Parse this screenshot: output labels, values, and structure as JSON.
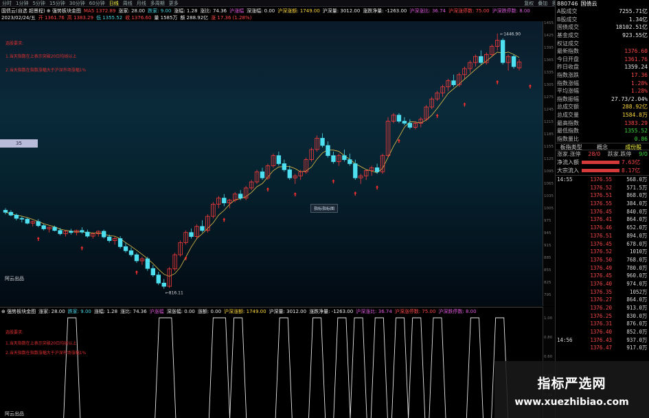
{
  "toolbar": {
    "left": [
      "分时",
      "1分钟",
      "5分钟",
      "15分钟",
      "30分钟",
      "60分钟",
      "日线",
      "周线",
      "月线",
      "多周期",
      "更多"
    ],
    "active_index": 6,
    "right": [
      "复权",
      "叠加",
      "多股",
      "统计",
      "画线",
      "F10",
      "标记",
      "+自选",
      "返回"
    ]
  },
  "infoline": [
    {
      "t": "国债云(自选 超景程) ⊕ 强势板块金图",
      "c": "white"
    },
    {
      "t": "MA5 1372.89",
      "c": "red"
    },
    {
      "t": "涨家: 28.00",
      "c": "white"
    },
    {
      "t": "跌家: 9.00",
      "c": "cyan"
    },
    {
      "t": "涨幅: 1.28",
      "c": "white"
    },
    {
      "t": "涨比: 74.36",
      "c": "white"
    },
    {
      "t": "沪涨幅",
      "c": "magenta"
    },
    {
      "t": "深涨幅: 0.00",
      "c": "white"
    },
    {
      "t": "沪深涨额: 1749.00",
      "c": "yellow"
    },
    {
      "t": "沪深量: 3012.00",
      "c": "white"
    },
    {
      "t": "涨跌净量: -1263.00",
      "c": "white"
    },
    {
      "t": "沪深涨比: 36.74",
      "c": "magenta"
    },
    {
      "t": "沪深涨停数: 75.00",
      "c": "red"
    },
    {
      "t": "沪深跌停数: 8.00",
      "c": "magenta"
    }
  ],
  "infoline2": [
    {
      "t": "2023/02/24/五",
      "c": "white"
    },
    {
      "t": "开 1361.76",
      "c": "red"
    },
    {
      "t": "高 1383.29",
      "c": "red"
    },
    {
      "t": "低 1355.52",
      "c": "cyan"
    },
    {
      "t": "收 1376.60",
      "c": "red"
    },
    {
      "t": "量 1585万",
      "c": "white"
    },
    {
      "t": "额 288.92亿",
      "c": "white"
    },
    {
      "t": "涨 17.36 (1.28%)",
      "c": "red"
    }
  ],
  "notes_main": [
    "选股要求:",
    "1.当天指数在上表示突破20日均线以上",
    "2.当天指数在指数涨幅大于沪深市场涨幅1%"
  ],
  "notes_sub": [
    "选股要求:",
    "1.当天指数在上表示突破20日均线以上",
    "2.当天指数在指数涨幅大于沪深市场涨幅1%"
  ],
  "brand_main": "阿云出品",
  "brand_sub": "阿云出品",
  "badge": "35",
  "tooltip": "指标指标图",
  "price_axis": [
    "1455",
    "1425",
    "1395",
    "1365",
    "1335",
    "1305",
    "1275",
    "1245",
    "1215",
    "1185",
    "1155",
    "1125",
    "1095",
    "1065",
    "1035",
    "1005",
    "975",
    "945",
    "915",
    "885",
    "855",
    "825",
    "795"
  ],
  "sub_header": [
    {
      "t": "⊕ 强势板块金图",
      "c": "white"
    },
    {
      "t": "涨家: 28.00",
      "c": "white"
    },
    {
      "t": "跌家: 9.00",
      "c": "cyan"
    },
    {
      "t": "涨幅: 1.28",
      "c": "white"
    },
    {
      "t": "涨比: 74.36",
      "c": "white"
    },
    {
      "t": "沪涨幅",
      "c": "magenta"
    },
    {
      "t": "深涨幅: 0.00",
      "c": "white"
    },
    {
      "t": "涨额: 0.00",
      "c": "white"
    },
    {
      "t": "沪深涨额: 1749.00",
      "c": "yellow"
    },
    {
      "t": "沪深量: 3012.00",
      "c": "white"
    },
    {
      "t": "涨跌净量: -1263.00",
      "c": "white"
    },
    {
      "t": "沪深涨比: 36.74",
      "c": "magenta"
    },
    {
      "t": "沪深涨停数: 75.00",
      "c": "red"
    },
    {
      "t": "沪深跌停数: 8.00",
      "c": "magenta"
    }
  ],
  "sub_axis": [
    "1.00",
    "0.80",
    "0.60",
    "0.40",
    "0.20"
  ],
  "chart_labels": {
    "high": "1446.90",
    "low": "816.11"
  },
  "chart_data": {
    "type": "candlestick",
    "title": "",
    "ylim": [
      790,
      1460
    ],
    "candles": [
      [
        1010,
        1015,
        1000,
        1005
      ],
      [
        1005,
        1010,
        995,
        998
      ],
      [
        998,
        1002,
        985,
        990
      ],
      [
        990,
        995,
        980,
        988
      ],
      [
        988,
        992,
        975,
        978
      ],
      [
        978,
        984,
        970,
        982
      ],
      [
        982,
        988,
        968,
        972
      ],
      [
        972,
        976,
        960,
        964
      ],
      [
        964,
        970,
        955,
        968
      ],
      [
        968,
        972,
        958,
        960
      ],
      [
        960,
        966,
        948,
        952
      ],
      [
        952,
        960,
        945,
        958
      ],
      [
        958,
        964,
        950,
        955
      ],
      [
        955,
        962,
        948,
        960
      ],
      [
        960,
        968,
        952,
        956
      ],
      [
        956,
        962,
        942,
        946
      ],
      [
        946,
        955,
        940,
        952
      ],
      [
        952,
        960,
        945,
        958
      ],
      [
        958,
        962,
        940,
        944
      ],
      [
        944,
        950,
        930,
        935
      ],
      [
        935,
        945,
        925,
        940
      ],
      [
        940,
        946,
        915,
        920
      ],
      [
        920,
        930,
        905,
        910
      ],
      [
        910,
        918,
        895,
        900
      ],
      [
        900,
        905,
        880,
        885
      ],
      [
        885,
        895,
        875,
        890
      ],
      [
        890,
        895,
        860,
        866
      ],
      [
        866,
        875,
        845,
        850
      ],
      [
        850,
        858,
        825,
        830
      ],
      [
        830,
        840,
        816,
        822
      ],
      [
        822,
        870,
        818,
        865
      ],
      [
        865,
        905,
        860,
        900
      ],
      [
        900,
        935,
        895,
        930
      ],
      [
        930,
        960,
        925,
        955
      ],
      [
        955,
        965,
        940,
        945
      ],
      [
        945,
        975,
        940,
        970
      ],
      [
        970,
        985,
        955,
        960
      ],
      [
        960,
        1000,
        955,
        995
      ],
      [
        995,
        1030,
        990,
        1025
      ],
      [
        1025,
        1045,
        1015,
        1040
      ],
      [
        1040,
        1050,
        1020,
        1028
      ],
      [
        1028,
        1038,
        1015,
        1035
      ],
      [
        1035,
        1055,
        1030,
        1050
      ],
      [
        1050,
        1060,
        1035,
        1040
      ],
      [
        1040,
        1070,
        1035,
        1065
      ],
      [
        1065,
        1085,
        1060,
        1080
      ],
      [
        1080,
        1110,
        1075,
        1105
      ],
      [
        1105,
        1115,
        1085,
        1090
      ],
      [
        1090,
        1125,
        1085,
        1120
      ],
      [
        1120,
        1150,
        1115,
        1145
      ],
      [
        1145,
        1155,
        1120,
        1125
      ],
      [
        1125,
        1135,
        1105,
        1110
      ],
      [
        1110,
        1120,
        1085,
        1090
      ],
      [
        1090,
        1100,
        1075,
        1095
      ],
      [
        1095,
        1110,
        1085,
        1105
      ],
      [
        1105,
        1140,
        1100,
        1135
      ],
      [
        1135,
        1165,
        1130,
        1160
      ],
      [
        1160,
        1195,
        1155,
        1188
      ],
      [
        1188,
        1200,
        1165,
        1170
      ],
      [
        1170,
        1180,
        1140,
        1145
      ],
      [
        1145,
        1155,
        1125,
        1130
      ],
      [
        1130,
        1150,
        1120,
        1145
      ],
      [
        1145,
        1160,
        1130,
        1135
      ],
      [
        1135,
        1150,
        1120,
        1125
      ],
      [
        1125,
        1135,
        1085,
        1090
      ],
      [
        1090,
        1100,
        1075,
        1095
      ],
      [
        1095,
        1110,
        1085,
        1108
      ],
      [
        1108,
        1120,
        1095,
        1115
      ],
      [
        1115,
        1125,
        1100,
        1105
      ],
      [
        1105,
        1150,
        1100,
        1145
      ],
      [
        1145,
        1240,
        1140,
        1230
      ],
      [
        1230,
        1250,
        1225,
        1245
      ],
      [
        1245,
        1250,
        1225,
        1230
      ],
      [
        1230,
        1240,
        1220,
        1225
      ],
      [
        1225,
        1235,
        1210,
        1215
      ],
      [
        1215,
        1230,
        1210,
        1225
      ],
      [
        1225,
        1240,
        1215,
        1235
      ],
      [
        1235,
        1270,
        1230,
        1265
      ],
      [
        1265,
        1290,
        1260,
        1285
      ],
      [
        1285,
        1305,
        1280,
        1300
      ],
      [
        1300,
        1320,
        1290,
        1315
      ],
      [
        1315,
        1335,
        1305,
        1330
      ],
      [
        1330,
        1345,
        1315,
        1320
      ],
      [
        1320,
        1350,
        1315,
        1345
      ],
      [
        1345,
        1365,
        1335,
        1360
      ],
      [
        1360,
        1380,
        1350,
        1375
      ],
      [
        1375,
        1395,
        1365,
        1390
      ],
      [
        1390,
        1405,
        1370,
        1375
      ],
      [
        1375,
        1400,
        1370,
        1395
      ],
      [
        1395,
        1420,
        1390,
        1415
      ],
      [
        1415,
        1446.9,
        1405,
        1430
      ],
      [
        1430,
        1435,
        1370,
        1375
      ],
      [
        1375,
        1395,
        1355,
        1390
      ],
      [
        1390,
        1395,
        1360,
        1365
      ],
      [
        1361.76,
        1383.29,
        1355.52,
        1376.6
      ]
    ],
    "signals": [
      {
        "x": 6,
        "y": 958
      },
      {
        "x": 14,
        "y": 935
      },
      {
        "x": 24,
        "y": 875
      },
      {
        "x": 33,
        "y": 910
      },
      {
        "x": 40,
        "y": 1005
      },
      {
        "x": 48,
        "y": 1080
      },
      {
        "x": 53,
        "y": 1068
      },
      {
        "x": 60,
        "y": 1100
      },
      {
        "x": 64,
        "y": 1070
      },
      {
        "x": 68,
        "y": 1085
      },
      {
        "x": 72,
        "y": 1200
      },
      {
        "x": 79,
        "y": 1262
      },
      {
        "x": 84,
        "y": 1290
      },
      {
        "x": 90,
        "y": 1345
      },
      {
        "x": 96,
        "y": 1335
      }
    ],
    "sub_spikes": [
      [
        15,
        17
      ],
      [
        37,
        40
      ],
      [
        50,
        53
      ],
      [
        55,
        57
      ],
      [
        66,
        68
      ],
      [
        74,
        76
      ],
      [
        80,
        82
      ],
      [
        84,
        86
      ],
      [
        89,
        91
      ],
      [
        94,
        96
      ],
      [
        98,
        100
      ],
      [
        103,
        105
      ],
      [
        112,
        114
      ],
      [
        118,
        120
      ]
    ]
  },
  "right_panel": {
    "code": "880746",
    "name": "国债云",
    "stats": [
      {
        "k": "A股成交",
        "v": "7255.71亿",
        "c": "white"
      },
      {
        "k": "B股成交",
        "v": "1.34亿",
        "c": "white"
      },
      {
        "k": "国债成交",
        "v": "18102.51亿",
        "c": "white"
      },
      {
        "k": "基金成交",
        "v": "923.55亿",
        "c": "white"
      },
      {
        "k": "权证成交",
        "v": "",
        "c": "white"
      },
      {
        "k": "最新指数",
        "v": "1376.60",
        "c": "red"
      },
      {
        "k": "今日开盘",
        "v": "1361.76",
        "c": "red"
      },
      {
        "k": "昨日收盘",
        "v": "1359.24",
        "c": "white"
      },
      {
        "k": "指数涨跌",
        "v": "17.36",
        "c": "red"
      },
      {
        "k": "指数涨幅",
        "v": "1.28%",
        "c": "red"
      },
      {
        "k": "平均涨幅",
        "v": "1.28%",
        "c": "red"
      },
      {
        "k": "指数振幅",
        "v": "27.73/2.04%",
        "c": "white"
      },
      {
        "k": "总成交额",
        "v": "288.92亿",
        "c": "yellow"
      },
      {
        "k": "总成交量",
        "v": "1584.8万",
        "c": "yellow"
      },
      {
        "k": "最高指数",
        "v": "1383.29",
        "c": "red"
      },
      {
        "k": "最低指数",
        "v": "1355.52",
        "c": "green"
      },
      {
        "k": "指数量比",
        "v": "0.86",
        "c": "green"
      }
    ],
    "tabs": [
      "板指类型",
      "概念",
      "成份股"
    ],
    "updown": {
      "k": "涨家.涨停",
      "v1": "28/0",
      "k2": "跌家.跌停",
      "v2": "9/0"
    },
    "flows": [
      {
        "k": "净流入额",
        "v": "7.63亿"
      },
      {
        "k": "大宗流入",
        "v": "8.17亿"
      }
    ],
    "ticks": [
      {
        "t": "14:55",
        "p": "1376.55",
        "v": "568.0",
        "u": "万"
      },
      {
        "t": "",
        "p": "1376.52",
        "v": "571.5",
        "u": "万"
      },
      {
        "t": "",
        "p": "1376.51",
        "v": "868.0",
        "u": "万"
      },
      {
        "t": "",
        "p": "1376.55",
        "v": "384.0",
        "u": "万"
      },
      {
        "t": "",
        "p": "1376.45",
        "v": "840.0",
        "u": "万"
      },
      {
        "t": "",
        "p": "1376.41",
        "v": "864.0",
        "u": "万"
      },
      {
        "t": "",
        "p": "1376.46",
        "v": "652.0",
        "u": "万"
      },
      {
        "t": "",
        "p": "1376.51",
        "v": "894.0",
        "u": "万"
      },
      {
        "t": "",
        "p": "1376.45",
        "v": "678.0",
        "u": "万"
      },
      {
        "t": "",
        "p": "1376.52",
        "v": "1010",
        "u": "万"
      },
      {
        "t": "",
        "p": "1376.50",
        "v": "768.0",
        "u": "万"
      },
      {
        "t": "",
        "p": "1376.49",
        "v": "780.0",
        "u": "万"
      },
      {
        "t": "",
        "p": "1376.45",
        "v": "960.0",
        "u": "万"
      },
      {
        "t": "",
        "p": "1376.40",
        "v": "974.0",
        "u": "万"
      },
      {
        "t": "",
        "p": "1376.35",
        "v": "1052",
        "u": "万"
      },
      {
        "t": "",
        "p": "1376.27",
        "v": "864.0",
        "u": "万"
      },
      {
        "t": "",
        "p": "1376.20",
        "v": "913.0",
        "u": "万"
      },
      {
        "t": "",
        "p": "1376.25",
        "v": "830.0",
        "u": "万"
      },
      {
        "t": "",
        "p": "1376.31",
        "v": "876.0",
        "u": "万"
      },
      {
        "t": "",
        "p": "1376.40",
        "v": "852.0",
        "u": "万"
      },
      {
        "t": "14:56",
        "p": "1376.43",
        "v": "937.0",
        "u": "万"
      },
      {
        "t": "",
        "p": "1376.47",
        "v": "917.0",
        "u": "万"
      }
    ]
  },
  "watermark": {
    "line1": "指标严选网",
    "line2": "www.xuezhibiao.com"
  }
}
